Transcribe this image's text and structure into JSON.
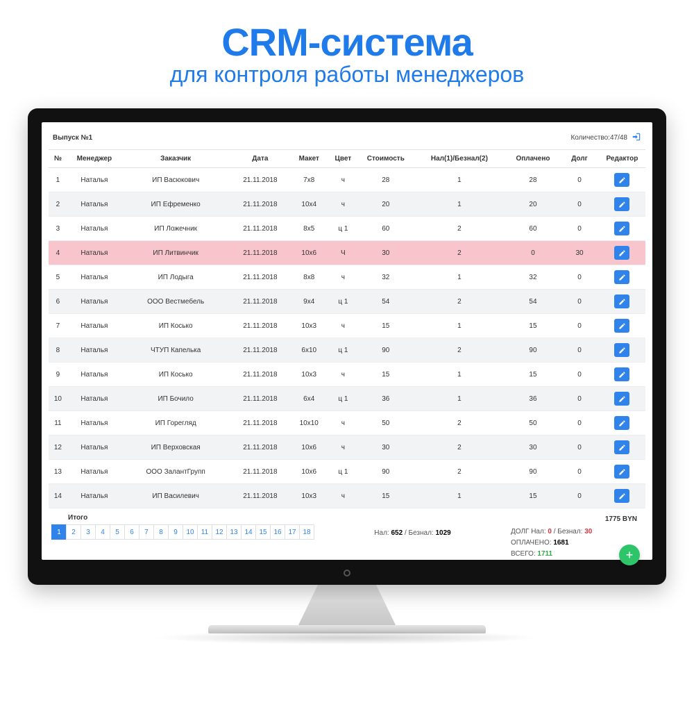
{
  "title": "CRM-система",
  "subtitle": "для контроля работы менеджеров",
  "issue_label": "Выпуск №1",
  "count_label": "Количество:47/48",
  "columns": [
    "№",
    "Менеджер",
    "Заказчик",
    "Дата",
    "Макет",
    "Цвет",
    "Стоимость",
    "Нал(1)/Безнал(2)",
    "Оплачено",
    "Долг",
    "Редактор"
  ],
  "rows": [
    {
      "n": "1",
      "mgr": "Наталья",
      "cust": "ИП Васюкович",
      "date": "21.11.2018",
      "maket": "7x8",
      "color": "ч",
      "cost": "28",
      "pay": "1",
      "paid": "28",
      "debt": "0",
      "hl": false
    },
    {
      "n": "2",
      "mgr": "Наталья",
      "cust": "ИП Ефременко",
      "date": "21.11.2018",
      "maket": "10x4",
      "color": "ч",
      "cost": "20",
      "pay": "1",
      "paid": "20",
      "debt": "0",
      "hl": false
    },
    {
      "n": "3",
      "mgr": "Наталья",
      "cust": "ИП Ложечник",
      "date": "21.11.2018",
      "maket": "8x5",
      "color": "ц 1",
      "cost": "60",
      "pay": "2",
      "paid": "60",
      "debt": "0",
      "hl": false
    },
    {
      "n": "4",
      "mgr": "Наталья",
      "cust": "ИП Литвинчик",
      "date": "21.11.2018",
      "maket": "10x6",
      "color": "Ч",
      "cost": "30",
      "pay": "2",
      "paid": "0",
      "debt": "30",
      "hl": true
    },
    {
      "n": "5",
      "mgr": "Наталья",
      "cust": "ИП Лодыга",
      "date": "21.11.2018",
      "maket": "8x8",
      "color": "ч",
      "cost": "32",
      "pay": "1",
      "paid": "32",
      "debt": "0",
      "hl": false
    },
    {
      "n": "6",
      "mgr": "Наталья",
      "cust": "ООО Вестмебель",
      "date": "21.11.2018",
      "maket": "9x4",
      "color": "ц 1",
      "cost": "54",
      "pay": "2",
      "paid": "54",
      "debt": "0",
      "hl": false
    },
    {
      "n": "7",
      "mgr": "Наталья",
      "cust": "ИП Косько",
      "date": "21.11.2018",
      "maket": "10x3",
      "color": "ч",
      "cost": "15",
      "pay": "1",
      "paid": "15",
      "debt": "0",
      "hl": false
    },
    {
      "n": "8",
      "mgr": "Наталья",
      "cust": "ЧТУП Капелька",
      "date": "21.11.2018",
      "maket": "6x10",
      "color": "ц 1",
      "cost": "90",
      "pay": "2",
      "paid": "90",
      "debt": "0",
      "hl": false
    },
    {
      "n": "9",
      "mgr": "Наталья",
      "cust": "ИП Косько",
      "date": "21.11.2018",
      "maket": "10x3",
      "color": "ч",
      "cost": "15",
      "pay": "1",
      "paid": "15",
      "debt": "0",
      "hl": false
    },
    {
      "n": "10",
      "mgr": "Наталья",
      "cust": "ИП Бочило",
      "date": "21.11.2018",
      "maket": "6x4",
      "color": "ц 1",
      "cost": "36",
      "pay": "1",
      "paid": "36",
      "debt": "0",
      "hl": false
    },
    {
      "n": "11",
      "mgr": "Наталья",
      "cust": "ИП Горегляд",
      "date": "21.11.2018",
      "maket": "10x10",
      "color": "ч",
      "cost": "50",
      "pay": "2",
      "paid": "50",
      "debt": "0",
      "hl": false
    },
    {
      "n": "12",
      "mgr": "Наталья",
      "cust": "ИП Верховская",
      "date": "21.11.2018",
      "maket": "10x6",
      "color": "ч",
      "cost": "30",
      "pay": "2",
      "paid": "30",
      "debt": "0",
      "hl": false
    },
    {
      "n": "13",
      "mgr": "Наталья",
      "cust": "ООО ЗалантГрупп",
      "date": "21.11.2018",
      "maket": "10x6",
      "color": "ц 1",
      "cost": "90",
      "pay": "2",
      "paid": "90",
      "debt": "0",
      "hl": false
    },
    {
      "n": "14",
      "mgr": "Наталья",
      "cust": "ИП Василевич",
      "date": "21.11.2018",
      "maket": "10x3",
      "color": "ч",
      "cost": "15",
      "pay": "1",
      "paid": "15",
      "debt": "0",
      "hl": false
    }
  ],
  "itogo_label": "Итого",
  "pages": [
    "1",
    "2",
    "3",
    "4",
    "5",
    "6",
    "7",
    "8",
    "9",
    "10",
    "11",
    "12",
    "13",
    "14",
    "15",
    "16",
    "17",
    "18"
  ],
  "active_page": "1",
  "summary": {
    "nal_label": "Нал:",
    "nal": "652",
    "beznal_label": "Безнал:",
    "beznal": "1029",
    "total_amt": "1775 BYN",
    "dolg_prefix": "ДОЛГ Нал:",
    "dolg_nal": "0",
    "dolg_beznal_label": "Безнал:",
    "dolg_beznal": "30",
    "paid_prefix": "ОПЛАЧЕНО:",
    "paid": "1681",
    "vsego_prefix": "ВСЕГО:",
    "vsego": "1711"
  }
}
